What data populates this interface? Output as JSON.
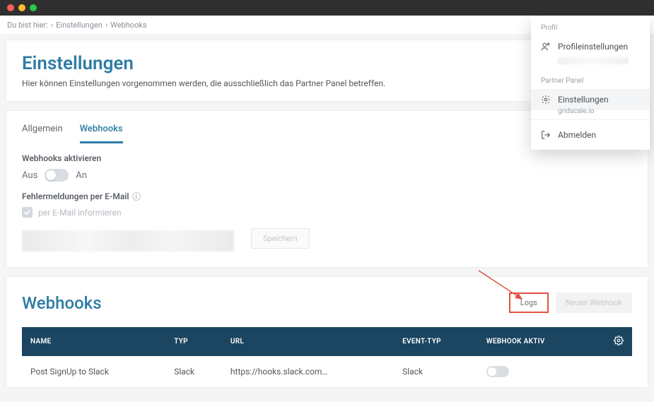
{
  "breadcrumb": {
    "prefix": "Du bist hier:",
    "items": [
      "Einstellungen",
      "Webhooks"
    ]
  },
  "dropdown": {
    "section1_label": "Profil",
    "profile_settings": "Profileinstellungen",
    "section2_label": "Partner Panel",
    "settings": "Einstellungen",
    "settings_sub": "gridscale.io",
    "logout": "Abmelden"
  },
  "settings_panel": {
    "title": "Einstellungen",
    "subtitle": "Hier können Einstellungen vorgenommen werden, die ausschließlich das Partner Panel betreffen."
  },
  "tabs": {
    "general": "Allgemein",
    "webhooks": "Webhooks"
  },
  "webhook_settings": {
    "activate_label": "Webhooks aktivieren",
    "off": "Aus",
    "on": "An",
    "error_mail_label": "Fehlermeldungen per E-Mail",
    "checkbox_label": "per E-Mail informieren",
    "save": "Speichern"
  },
  "webhooks_section": {
    "title": "Webhooks",
    "logs_btn": "Logs",
    "new_btn": "Neuen Webhook"
  },
  "table": {
    "headers": {
      "name": "NAME",
      "type": "TYP",
      "url": "URL",
      "event_type": "EVENT-TYP",
      "active": "WEBHOOK AKTIV"
    },
    "rows": [
      {
        "name": "Post SignUp to Slack",
        "type": "Slack",
        "url": "https://hooks.slack.com…",
        "event_type": "Slack"
      }
    ]
  }
}
